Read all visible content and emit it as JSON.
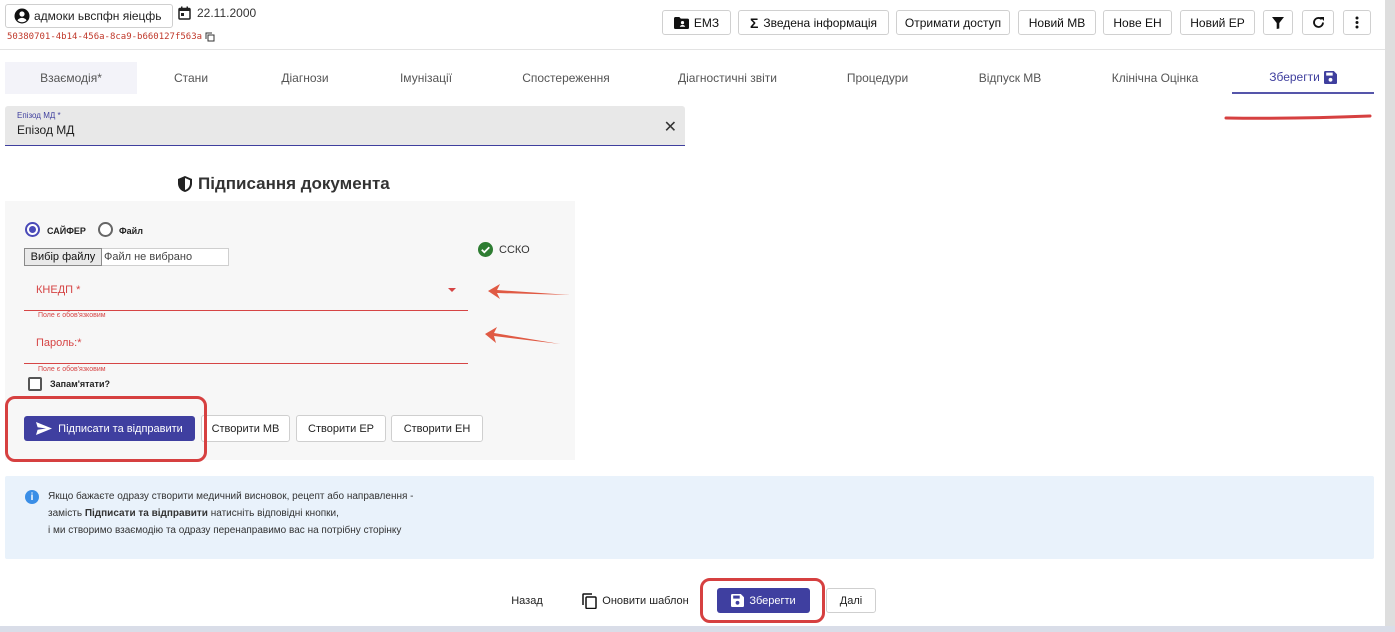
{
  "header": {
    "patient_name": "адмоки ьвспфн яіецфь",
    "date": "22.11.2000",
    "uuid": "50380701-4b14-456a-8ca9-b660127f563a",
    "buttons": [
      "ЕМЗ",
      "Зведена інформація",
      "Отримати доступ",
      "Новий МВ",
      "Нове ЕН",
      "Новий ЕР"
    ]
  },
  "tabs": [
    "Взаємодія*",
    "Стани",
    "Діагнози",
    "Імунізації",
    "Спостереження",
    "Діагностичні звіти",
    "Процедури",
    "Відпуск МВ",
    "Клінічна Оцінка",
    "Зберегти"
  ],
  "episode": {
    "label": "Епізод МД *",
    "value": "Епізод МД"
  },
  "signing": {
    "title": "Підписання документа",
    "radio_cipher": "САЙФЕР",
    "radio_file": "Файл",
    "file_button": "Вибір файлу",
    "file_placeholder": "Файл не вибрано",
    "csko": "ССКО",
    "kep_label": "КНЕДП *",
    "password_label": "Пароль:*",
    "required_hint": "Поле є обов'язковим",
    "remember": "Запам'ятати?",
    "sign_button": "Підписати та відправити",
    "create_mv": "Створити МВ",
    "create_er": "Створити ЕР",
    "create_en": "Створити ЕН"
  },
  "info": {
    "line1": "Якщо бажаєте одразу створити медичний висновок, рецепт або направлення -",
    "line2_prefix": "замість ",
    "line2_bold": "Підписати та відправити",
    "line2_suffix": " натисніть відповідні кнопки,",
    "line3": "і ми створимо взаємодію та одразу перенаправимо вас на потрібну сторінку"
  },
  "footer": {
    "back": "Назад",
    "refresh_template": "Оновити шаблон",
    "save": "Зберегти",
    "next": "Далі"
  },
  "colors": {
    "primary": "#3f3fa0",
    "error": "#d64545",
    "annotation": "#d64040",
    "info_bg": "#e9f2fb"
  }
}
